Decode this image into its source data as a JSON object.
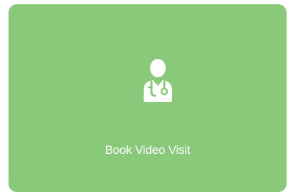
{
  "card": {
    "label": "Book Video Visit",
    "icon": "doctor-icon",
    "background_color": "#88c97a",
    "text_color": "#ffffff"
  }
}
